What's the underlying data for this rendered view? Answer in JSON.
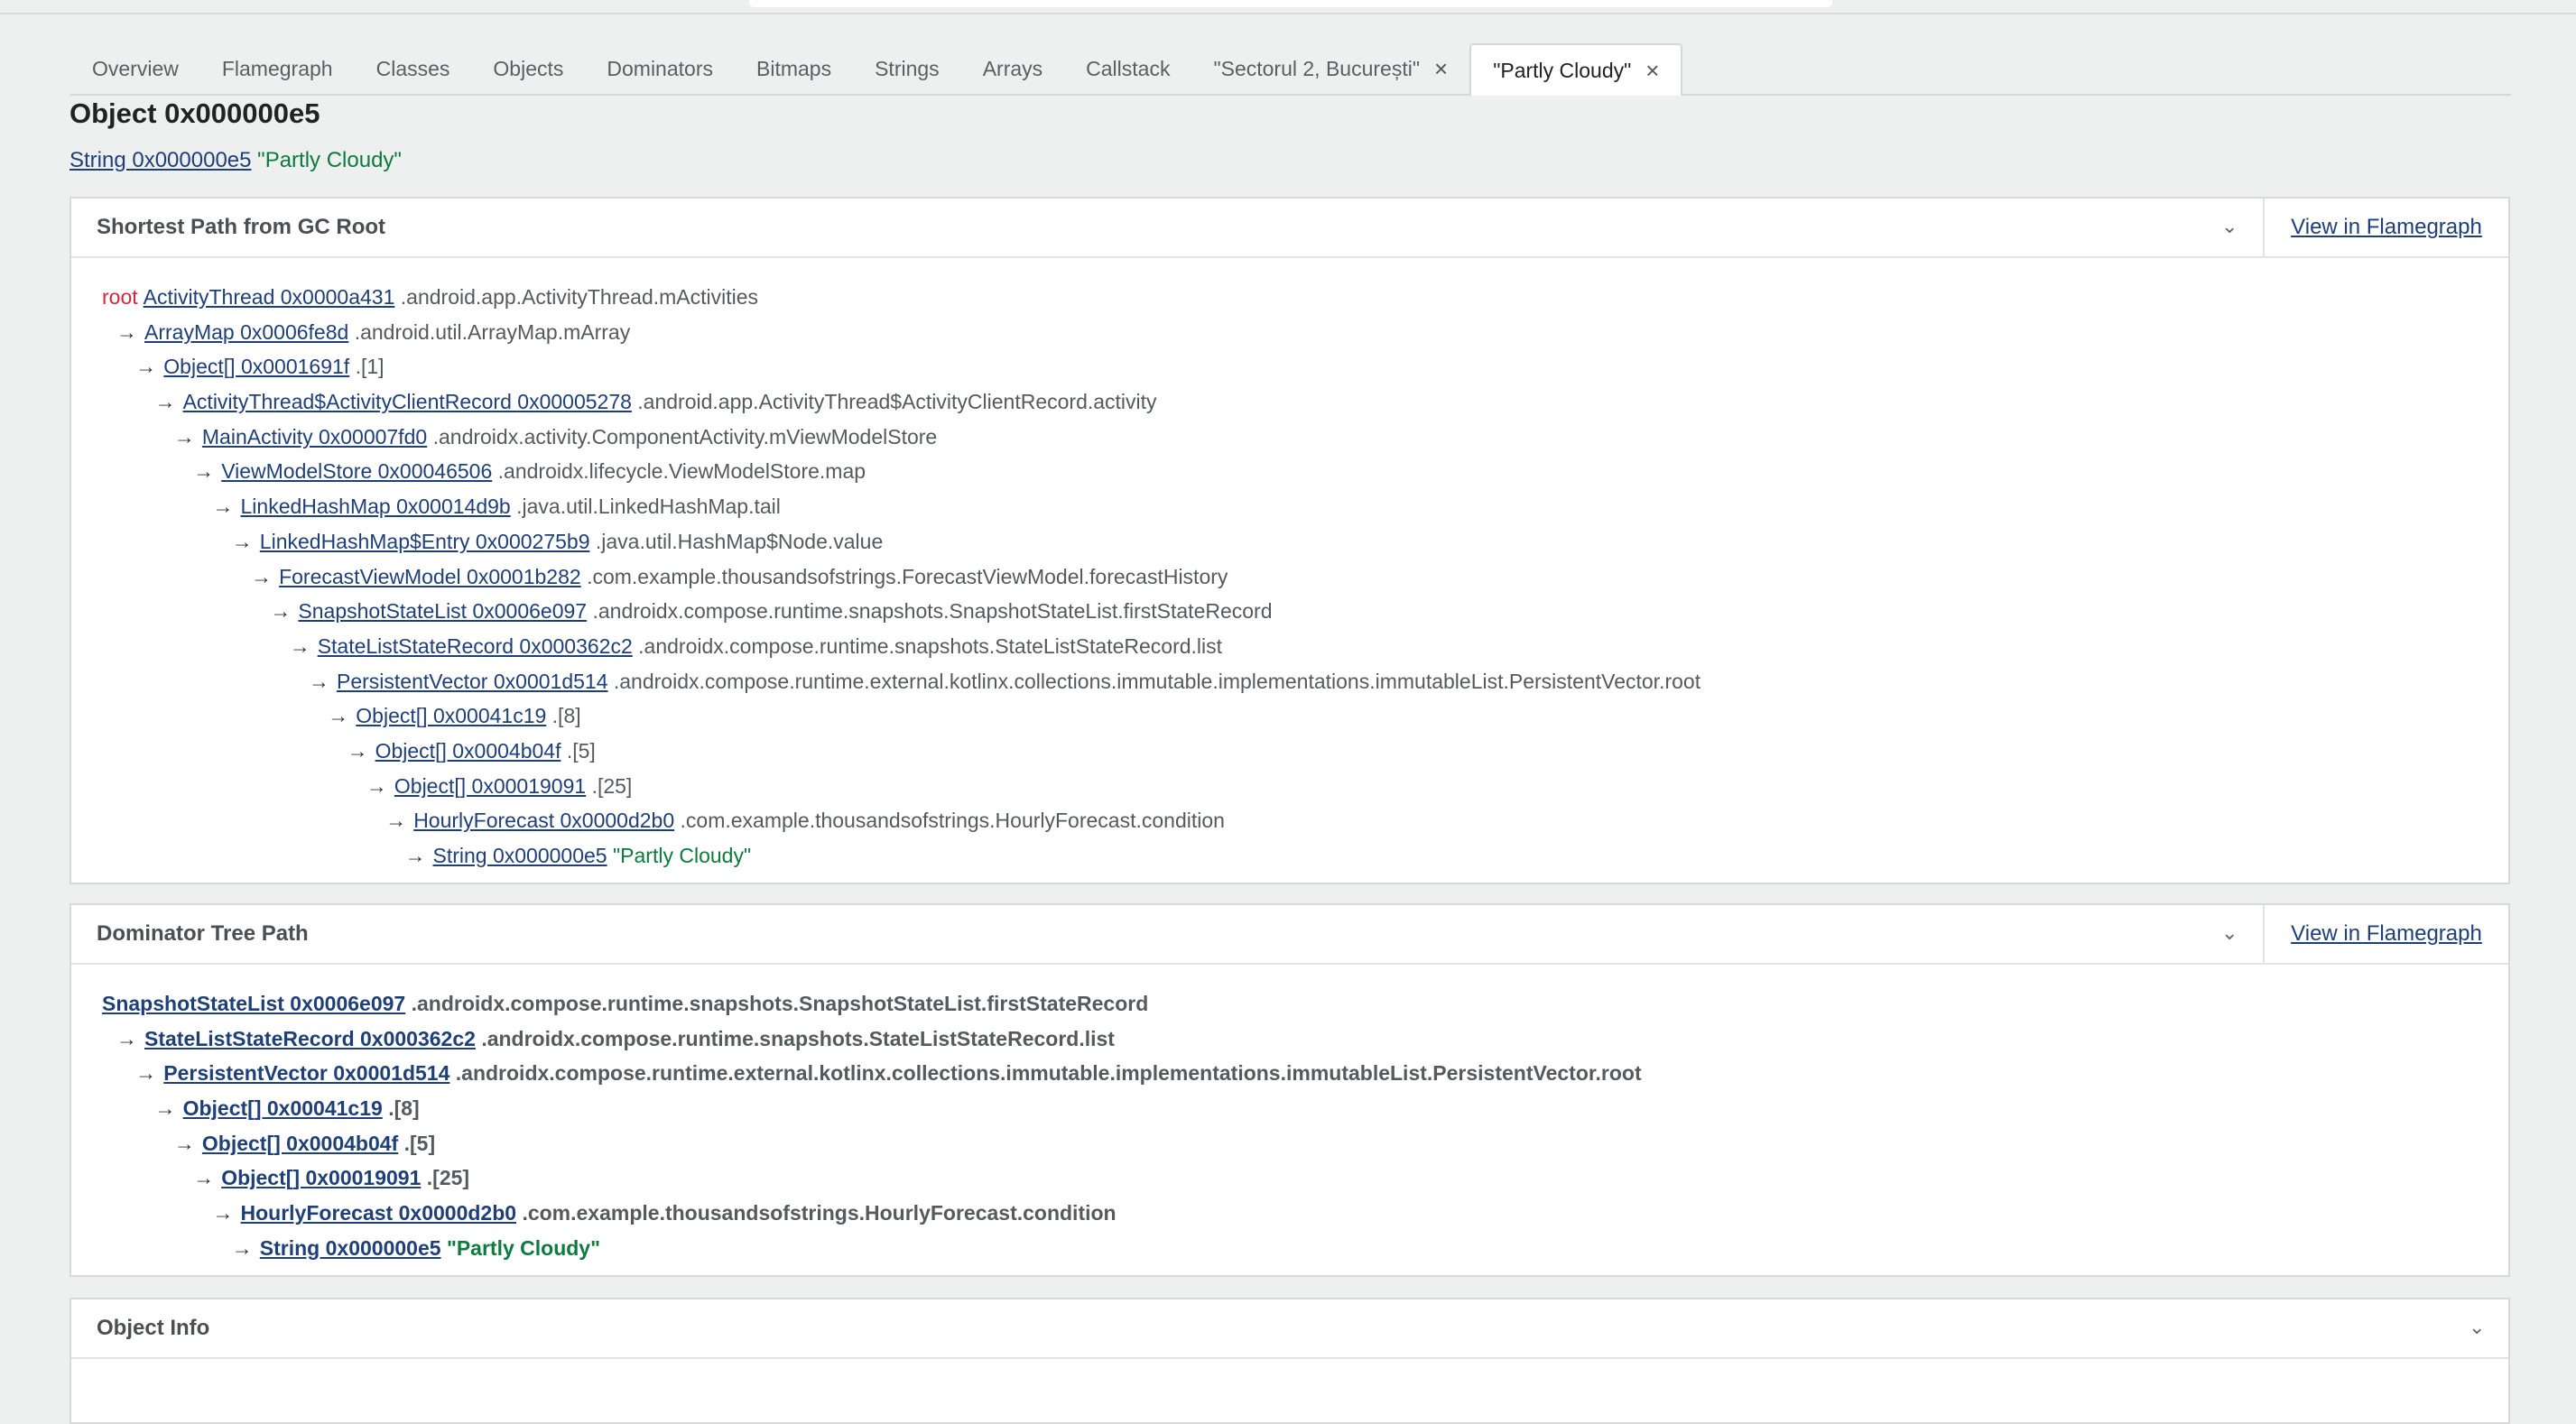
{
  "tabs": [
    {
      "label": "Overview"
    },
    {
      "label": "Flamegraph"
    },
    {
      "label": "Classes"
    },
    {
      "label": "Objects"
    },
    {
      "label": "Dominators"
    },
    {
      "label": "Bitmaps"
    },
    {
      "label": "Strings"
    },
    {
      "label": "Arrays"
    },
    {
      "label": "Callstack"
    },
    {
      "label": "\"Sectorul 2, București\"",
      "closable": true
    },
    {
      "label": "\"Partly Cloudy\"",
      "closable": true,
      "active": true
    }
  ],
  "page_title": "Object 0x000000e5",
  "subline": {
    "link": "String 0x000000e5",
    "value": "\"Partly Cloudy\""
  },
  "shortest_path": {
    "title": "Shortest Path from GC Root",
    "view_label": "View in Flamegraph",
    "root_label": "root",
    "rows": [
      {
        "link": "ActivityThread 0x0000a431",
        "field": ".android.app.ActivityThread.mActivities"
      },
      {
        "link": "ArrayMap 0x0006fe8d",
        "field": ".android.util.ArrayMap.mArray"
      },
      {
        "link": "Object[] 0x0001691f",
        "field": ".[1]"
      },
      {
        "link": "ActivityThread$ActivityClientRecord 0x00005278",
        "field": ".android.app.ActivityThread$ActivityClientRecord.activity"
      },
      {
        "link": "MainActivity 0x00007fd0",
        "field": ".androidx.activity.ComponentActivity.mViewModelStore"
      },
      {
        "link": "ViewModelStore 0x00046506",
        "field": ".androidx.lifecycle.ViewModelStore.map"
      },
      {
        "link": "LinkedHashMap 0x00014d9b",
        "field": ".java.util.LinkedHashMap.tail"
      },
      {
        "link": "LinkedHashMap$Entry 0x000275b9",
        "field": ".java.util.HashMap$Node.value"
      },
      {
        "link": "ForecastViewModel 0x0001b282",
        "field": ".com.example.thousandsofstrings.ForecastViewModel.forecastHistory"
      },
      {
        "link": "SnapshotStateList 0x0006e097",
        "field": ".androidx.compose.runtime.snapshots.SnapshotStateList.firstStateRecord"
      },
      {
        "link": "StateListStateRecord 0x000362c2",
        "field": ".androidx.compose.runtime.snapshots.StateListStateRecord.list"
      },
      {
        "link": "PersistentVector 0x0001d514",
        "field": ".androidx.compose.runtime.external.kotlinx.collections.immutable.implementations.immutableList.PersistentVector.root"
      },
      {
        "link": "Object[] 0x00041c19",
        "field": ".[8]"
      },
      {
        "link": "Object[] 0x0004b04f",
        "field": ".[5]"
      },
      {
        "link": "Object[] 0x00019091",
        "field": ".[25]"
      },
      {
        "link": "HourlyForecast 0x0000d2b0",
        "field": ".com.example.thousandsofstrings.HourlyForecast.condition"
      },
      {
        "link": "String 0x000000e5",
        "value": "\"Partly Cloudy\""
      }
    ]
  },
  "dominator_path": {
    "title": "Dominator Tree Path",
    "view_label": "View in Flamegraph",
    "rows": [
      {
        "link": "SnapshotStateList 0x0006e097",
        "field": ".androidx.compose.runtime.snapshots.SnapshotStateList.firstStateRecord"
      },
      {
        "link": "StateListStateRecord 0x000362c2",
        "field": ".androidx.compose.runtime.snapshots.StateListStateRecord.list"
      },
      {
        "link": "PersistentVector 0x0001d514",
        "field": ".androidx.compose.runtime.external.kotlinx.collections.immutable.implementations.immutableList.PersistentVector.root"
      },
      {
        "link": "Object[] 0x00041c19",
        "field": ".[8]"
      },
      {
        "link": "Object[] 0x0004b04f",
        "field": ".[5]"
      },
      {
        "link": "Object[] 0x00019091",
        "field": ".[25]"
      },
      {
        "link": "HourlyForecast 0x0000d2b0",
        "field": ".com.example.thousandsofstrings.HourlyForecast.condition"
      },
      {
        "link": "String 0x000000e5",
        "value": "\"Partly Cloudy\""
      }
    ]
  },
  "object_info": {
    "title": "Object Info"
  },
  "icons": {
    "close": "close-icon",
    "collapse": "chevron-down-icon",
    "arrow": "right-arrow-icon"
  },
  "colors": {
    "link": "#1f3f78",
    "string": "#0d7a3e",
    "root": "#d3283c"
  }
}
